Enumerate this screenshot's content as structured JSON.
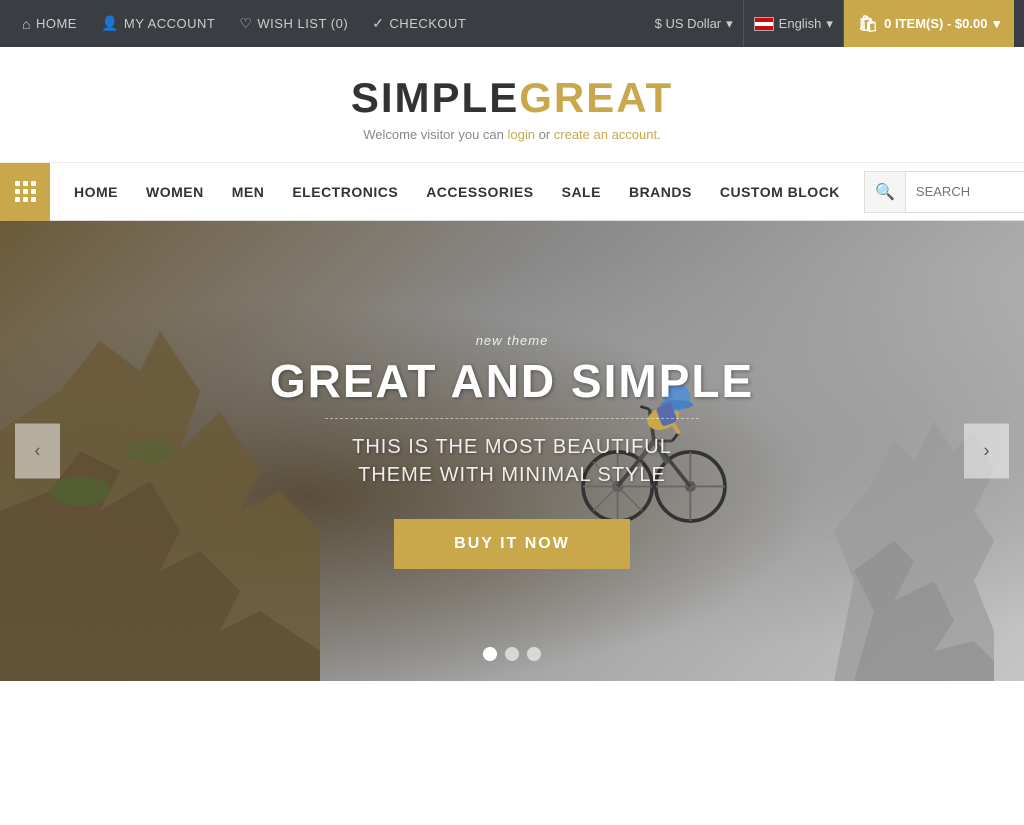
{
  "topnav": {
    "home_label": "HOME",
    "account_label": "MY ACCOUNT",
    "wishlist_label": "WISH LIST (0)",
    "checkout_label": "CHECKOUT",
    "currency_label": "$ US Dollar",
    "language_label": "English",
    "cart_label": "0 ITEM(S) - $0.00"
  },
  "header": {
    "logo_simple": "SIMPLE",
    "logo_great": "GREAT",
    "welcome_text": "Welcome visitor you can ",
    "login_text": "login",
    "or_text": " or ",
    "create_account_text": "create an account",
    "period": "."
  },
  "mainnav": {
    "items": [
      {
        "label": "HOME"
      },
      {
        "label": "WOMEN"
      },
      {
        "label": "MEN"
      },
      {
        "label": "ELECTRONICS"
      },
      {
        "label": "ACCESSORIES"
      },
      {
        "label": "SALE"
      },
      {
        "label": "BRANDS"
      },
      {
        "label": "CUSTOM BLOCK"
      }
    ],
    "search_placeholder": "SEARCH"
  },
  "hero": {
    "subtitle": "new theme",
    "title": "GREAT AND SIMPLE",
    "description_line1": "THIS IS THE MOST BEAUTIFUL",
    "description_line2": "THEME WITH MINIMAL STYLE",
    "cta_label": "BUY IT NOW",
    "dots": [
      {
        "active": true
      },
      {
        "active": false
      },
      {
        "active": false
      }
    ]
  }
}
